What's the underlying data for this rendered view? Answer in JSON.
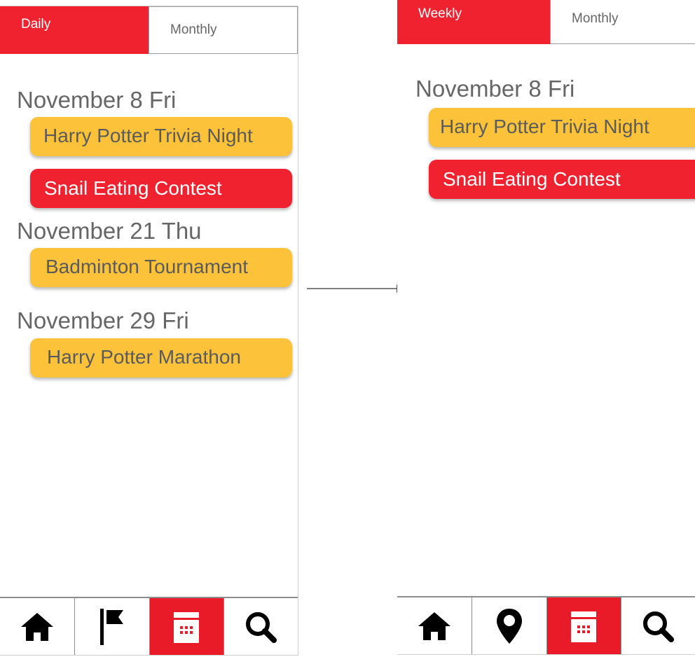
{
  "left_screen": {
    "tabs": {
      "active": "Daily",
      "inactive": "Monthly"
    },
    "days": [
      {
        "heading": "November 8 Fri",
        "events": [
          {
            "title": "Harry Potter Trivia Night",
            "color": "yellow"
          },
          {
            "title": "Snail Eating Contest",
            "color": "red"
          }
        ]
      },
      {
        "heading": "November 21 Thu",
        "events": [
          {
            "title": "Badminton Tournament",
            "color": "yellow"
          }
        ]
      },
      {
        "heading": "November 29 Fri",
        "events": [
          {
            "title": "Harry Potter Marathon",
            "color": "yellow"
          }
        ]
      }
    ],
    "nav": [
      {
        "icon": "home-icon",
        "active": false
      },
      {
        "icon": "flag-icon",
        "active": false
      },
      {
        "icon": "calendar-icon",
        "active": true
      },
      {
        "icon": "search-icon",
        "active": false
      }
    ]
  },
  "right_screen": {
    "tabs": {
      "active": "Weekly",
      "inactive": "Monthly"
    },
    "days": [
      {
        "heading": "November 8 Fri",
        "events": [
          {
            "title": "Harry Potter Trivia Night",
            "color": "yellow"
          },
          {
            "title": "Snail Eating Contest",
            "color": "red"
          }
        ]
      }
    ],
    "nav": [
      {
        "icon": "home-icon",
        "active": false
      },
      {
        "icon": "location-pin-icon",
        "active": false
      },
      {
        "icon": "calendar-icon",
        "active": true
      },
      {
        "icon": "search-icon",
        "active": false
      }
    ]
  },
  "colors": {
    "accent_red": "#f0222f",
    "event_yellow": "#fcc33a",
    "text_gray": "#666666"
  }
}
